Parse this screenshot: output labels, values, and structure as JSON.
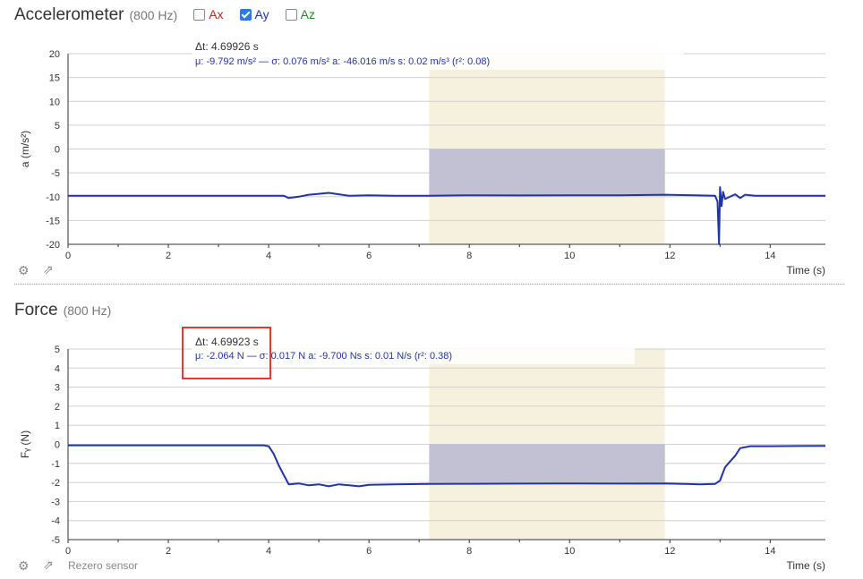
{
  "accel": {
    "title": "Accelerometer",
    "rate": "(800 Hz)",
    "checkboxes": [
      {
        "label": "Ax",
        "checked": false,
        "color": "#cc2222"
      },
      {
        "label": "Ay",
        "checked": true,
        "color": "#2233aa"
      },
      {
        "label": "Az",
        "checked": false,
        "color": "#22882a"
      }
    ]
  },
  "force": {
    "title": "Force",
    "rate": "(800 Hz)",
    "rezero_label": "Rezero sensor"
  },
  "icons": [
    "gear-icon",
    "popout-icon"
  ],
  "colors": {
    "series": "#2233aa",
    "selection": "#f6f1de",
    "selection_band": "#c2c1d4"
  },
  "chart_data": [
    {
      "type": "line",
      "ylabel": "a (m/s²)",
      "xlabel": "Time (s)",
      "xlim": [
        0,
        15.1
      ],
      "ylim": [
        -20,
        20
      ],
      "yticks": [
        -20,
        -15,
        -10,
        -5,
        0,
        5,
        10,
        15,
        20
      ],
      "xticks": [
        0,
        2,
        4,
        6,
        8,
        10,
        12,
        14
      ],
      "selection": {
        "start": 7.2,
        "end": 11.9,
        "band_from": -9.8,
        "band_to": 0
      },
      "annotation": {
        "line1": "Δt: 4.69926 s",
        "line2": "μ: -9.792 m/s² — σ: 0.076 m/s²   a: -46.016 m/s   s: 0.02 m/s³ (r²: 0.08)"
      },
      "series": [
        {
          "values": [
            [
              0,
              -9.8
            ],
            [
              4.3,
              -9.8
            ],
            [
              4.4,
              -10.3
            ],
            [
              4.6,
              -10.0
            ],
            [
              4.8,
              -9.6
            ],
            [
              5.0,
              -9.4
            ],
            [
              5.2,
              -9.2
            ],
            [
              5.4,
              -9.5
            ],
            [
              5.6,
              -9.8
            ],
            [
              6.0,
              -9.7
            ],
            [
              6.5,
              -9.8
            ],
            [
              7.2,
              -9.8
            ],
            [
              8.0,
              -9.7
            ],
            [
              9.0,
              -9.75
            ],
            [
              10.0,
              -9.7
            ],
            [
              11.0,
              -9.7
            ],
            [
              11.9,
              -9.6
            ],
            [
              12.5,
              -9.7
            ],
            [
              12.9,
              -9.8
            ],
            [
              12.95,
              -11
            ],
            [
              12.98,
              -20
            ],
            [
              13.0,
              -8.0
            ],
            [
              13.03,
              -12
            ],
            [
              13.06,
              -9.0
            ],
            [
              13.1,
              -10.5
            ],
            [
              13.3,
              -9.5
            ],
            [
              13.4,
              -10.3
            ],
            [
              13.5,
              -9.6
            ],
            [
              13.7,
              -9.8
            ],
            [
              15.1,
              -9.8
            ]
          ]
        }
      ]
    },
    {
      "type": "line",
      "ylabel": "Fᵧ (N)",
      "xlabel": "Time (s)",
      "xlim": [
        0,
        15.1
      ],
      "ylim": [
        -5,
        5
      ],
      "yticks": [
        -5,
        -4,
        -3,
        -2,
        -1,
        0,
        1,
        2,
        3,
        4,
        5
      ],
      "xticks": [
        0,
        2,
        4,
        6,
        8,
        10,
        12,
        14
      ],
      "selection": {
        "start": 7.2,
        "end": 11.9,
        "band_from": -2.06,
        "band_to": 0
      },
      "annotation": {
        "line1": "Δt: 4.69923 s",
        "line2": "μ: -2.064 N — σ: 0.017 N   a: -9.700 Ns   s: 0.01 N/s (r²: 0.38)"
      },
      "series": [
        {
          "values": [
            [
              0,
              -0.05
            ],
            [
              3.9,
              -0.05
            ],
            [
              4.0,
              -0.1
            ],
            [
              4.1,
              -0.5
            ],
            [
              4.2,
              -1.1
            ],
            [
              4.3,
              -1.6
            ],
            [
              4.4,
              -2.1
            ],
            [
              4.6,
              -2.05
            ],
            [
              4.8,
              -2.15
            ],
            [
              5.0,
              -2.1
            ],
            [
              5.2,
              -2.2
            ],
            [
              5.4,
              -2.1
            ],
            [
              5.6,
              -2.15
            ],
            [
              5.8,
              -2.2
            ],
            [
              6.0,
              -2.12
            ],
            [
              6.5,
              -2.1
            ],
            [
              7.2,
              -2.08
            ],
            [
              8.0,
              -2.07
            ],
            [
              9.0,
              -2.06
            ],
            [
              10.0,
              -2.05
            ],
            [
              11.0,
              -2.06
            ],
            [
              11.9,
              -2.05
            ],
            [
              12.3,
              -2.08
            ],
            [
              12.6,
              -2.1
            ],
            [
              12.9,
              -2.08
            ],
            [
              13.0,
              -1.9
            ],
            [
              13.1,
              -1.2
            ],
            [
              13.2,
              -0.9
            ],
            [
              13.3,
              -0.6
            ],
            [
              13.4,
              -0.2
            ],
            [
              13.6,
              -0.1
            ],
            [
              14.0,
              -0.1
            ],
            [
              15.1,
              -0.08
            ]
          ]
        }
      ]
    }
  ]
}
